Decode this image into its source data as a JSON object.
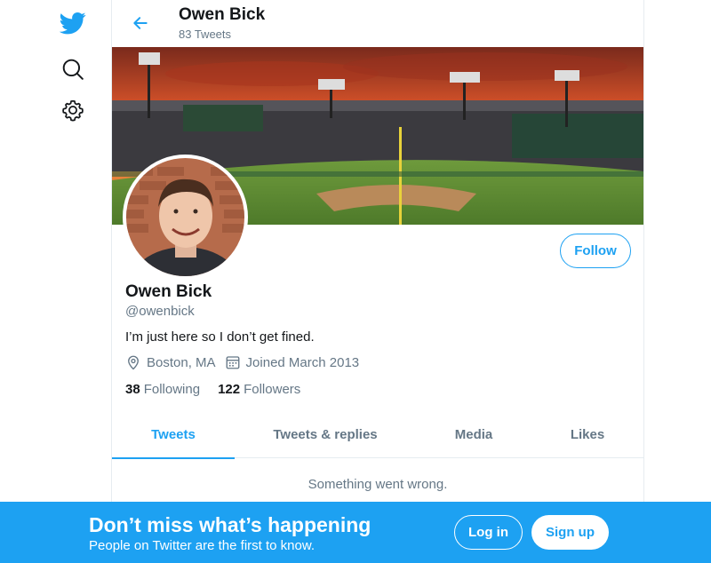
{
  "colors": {
    "accent": "#1da1f2",
    "text_primary": "#14171a",
    "text_secondary": "#657786",
    "divider": "#e6ecf0"
  },
  "nav": {
    "logo_icon": "twitter-bird-icon",
    "items": [
      {
        "icon": "search-icon",
        "label": "Explore"
      },
      {
        "icon": "gear-icon",
        "label": "Settings"
      }
    ]
  },
  "header": {
    "back_icon": "arrow-left-icon",
    "name": "Owen Bick",
    "tweet_count": "83 Tweets"
  },
  "profile": {
    "name": "Owen Bick",
    "handle": "@owenbick",
    "bio": "I’m just here so I don’t get fined.",
    "location": "Boston, MA",
    "joined": "Joined March 2013",
    "following_count": "38",
    "following_label": "Following",
    "followers_count": "122",
    "followers_label": "Followers",
    "follow_button": "Follow"
  },
  "tabs": [
    {
      "label": "Tweets",
      "active": true
    },
    {
      "label": "Tweets & replies",
      "active": false
    },
    {
      "label": "Media",
      "active": false
    },
    {
      "label": "Likes",
      "active": false
    }
  ],
  "feed": {
    "error_message": "Something went wrong."
  },
  "bottom_bar": {
    "title": "Don’t miss what’s happening",
    "subtitle": "People on Twitter are the first to know.",
    "login_label": "Log in",
    "signup_label": "Sign up"
  }
}
